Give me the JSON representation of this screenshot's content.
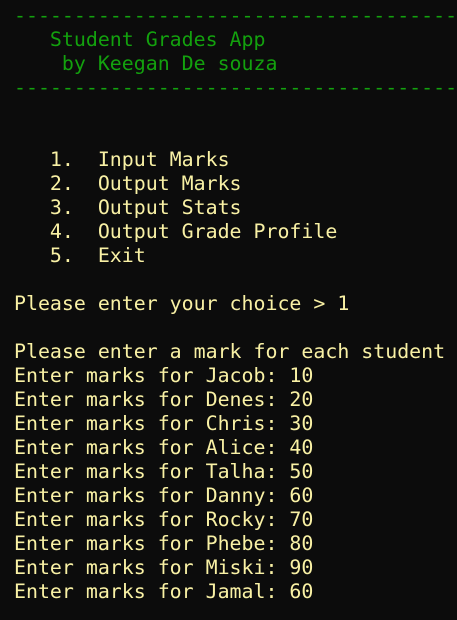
{
  "colors": {
    "background": "#0c0c0c",
    "header": "#13a10e",
    "body_text": "#f9f1a5"
  },
  "header": {
    "rule": "----------------------------------------",
    "title": "   Student Grades App",
    "author": "    by Keegan De souza"
  },
  "menu": [
    "   1.  Input Marks",
    "   2.  Output Marks",
    "   3.  Output Stats",
    "   4.  Output Grade Profile",
    "   5.  Exit"
  ],
  "prompt": "Please enter your choice > 1",
  "instruction": "Please enter a mark for each student",
  "entries": [
    "Enter marks for Jacob: 10",
    "Enter marks for Denes: 20",
    "Enter marks for Chris: 30",
    "Enter marks for Alice: 40",
    "Enter marks for Talha: 50",
    "Enter marks for Danny: 60",
    "Enter marks for Rocky: 70",
    "Enter marks for Phebe: 80",
    "Enter marks for Miski: 90",
    "Enter marks for Jamal: 60"
  ]
}
